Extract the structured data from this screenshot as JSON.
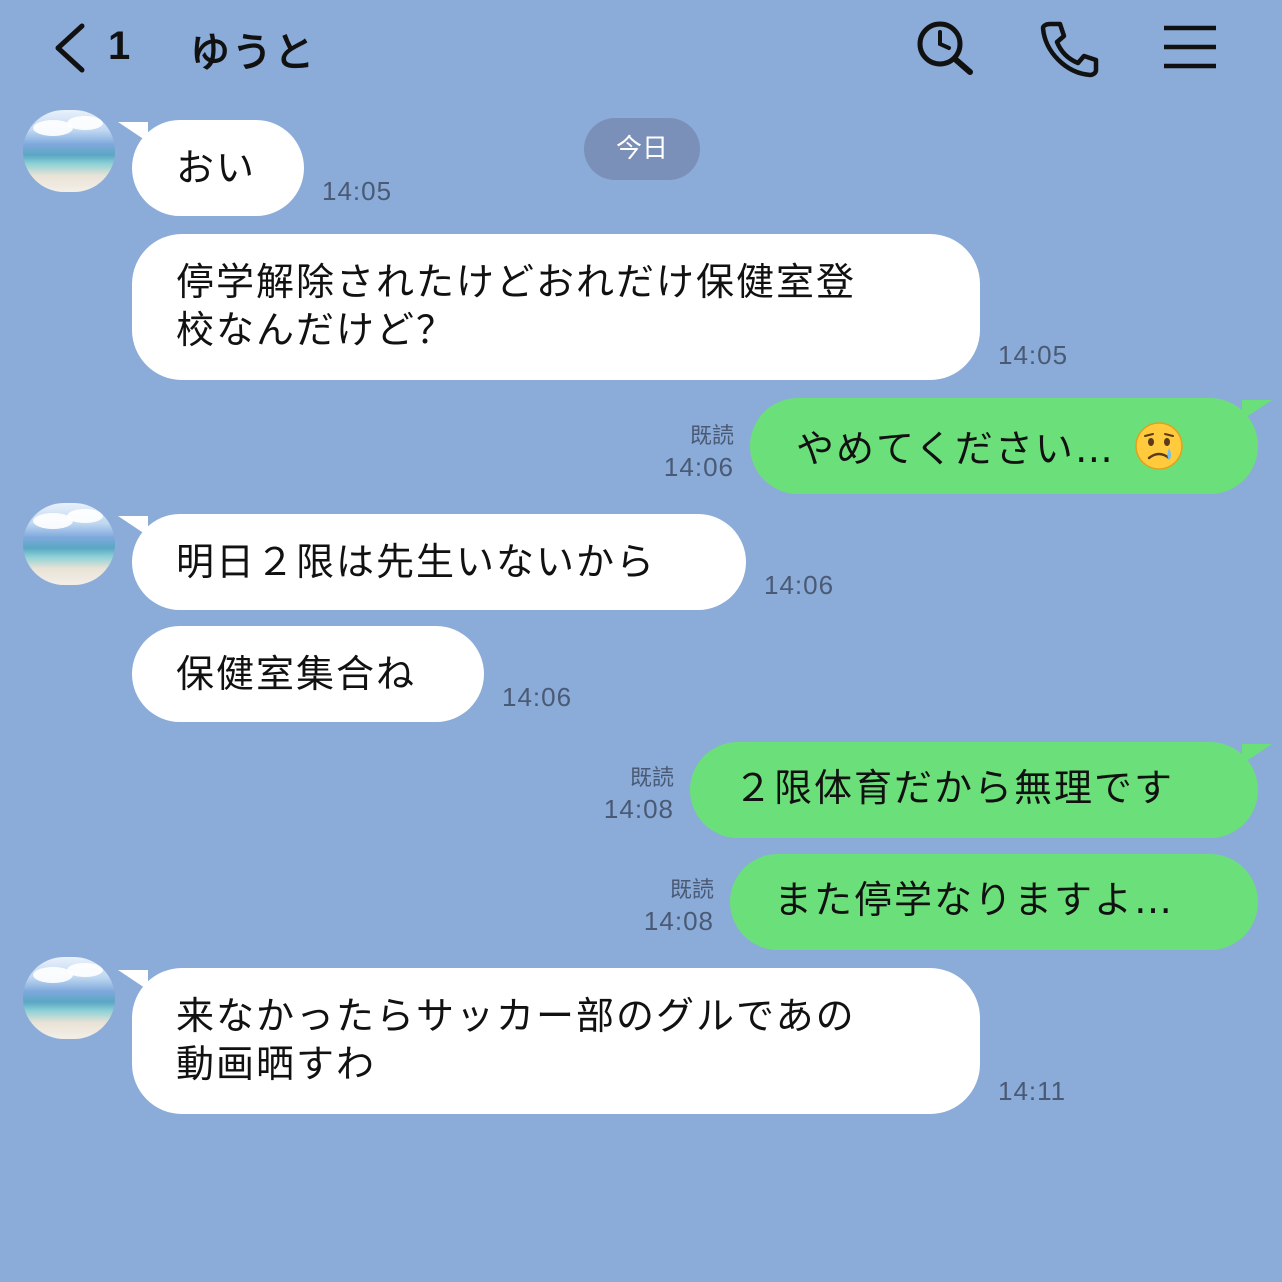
{
  "header": {
    "back_count": "1",
    "title": "ゆうと",
    "icons": [
      "back-chevron-icon",
      "search-icon",
      "phone-icon",
      "menu-icon"
    ]
  },
  "date_label": "今日",
  "read_label": "既読",
  "colors": {
    "background": "#8BABD8",
    "incoming_bubble": "#FFFFFF",
    "outgoing_bubble": "#6BE07A",
    "date_pill": "#7A90B8"
  },
  "messages": [
    {
      "dir": "in",
      "text": "おい",
      "time": "14:05"
    },
    {
      "dir": "in",
      "text": "停学解除されたけどおれだけ保健室登\n校なんだけど？",
      "time": "14:05"
    },
    {
      "dir": "out",
      "text": "やめてください…",
      "emoji": "crying-face-emoji",
      "time": "14:06",
      "read": true
    },
    {
      "dir": "in",
      "text": "明日２限は先生いないから",
      "time": "14:06"
    },
    {
      "dir": "in",
      "text": "保健室集合ね",
      "time": "14:06"
    },
    {
      "dir": "out",
      "text": "２限体育だから無理です",
      "time": "14:08",
      "read": true
    },
    {
      "dir": "out",
      "text": "また停学なりますよ…",
      "time": "14:08",
      "read": true
    },
    {
      "dir": "in",
      "text": "来なかったらサッカー部のグルであの\n動画晒すわ",
      "time": "14:11"
    }
  ]
}
